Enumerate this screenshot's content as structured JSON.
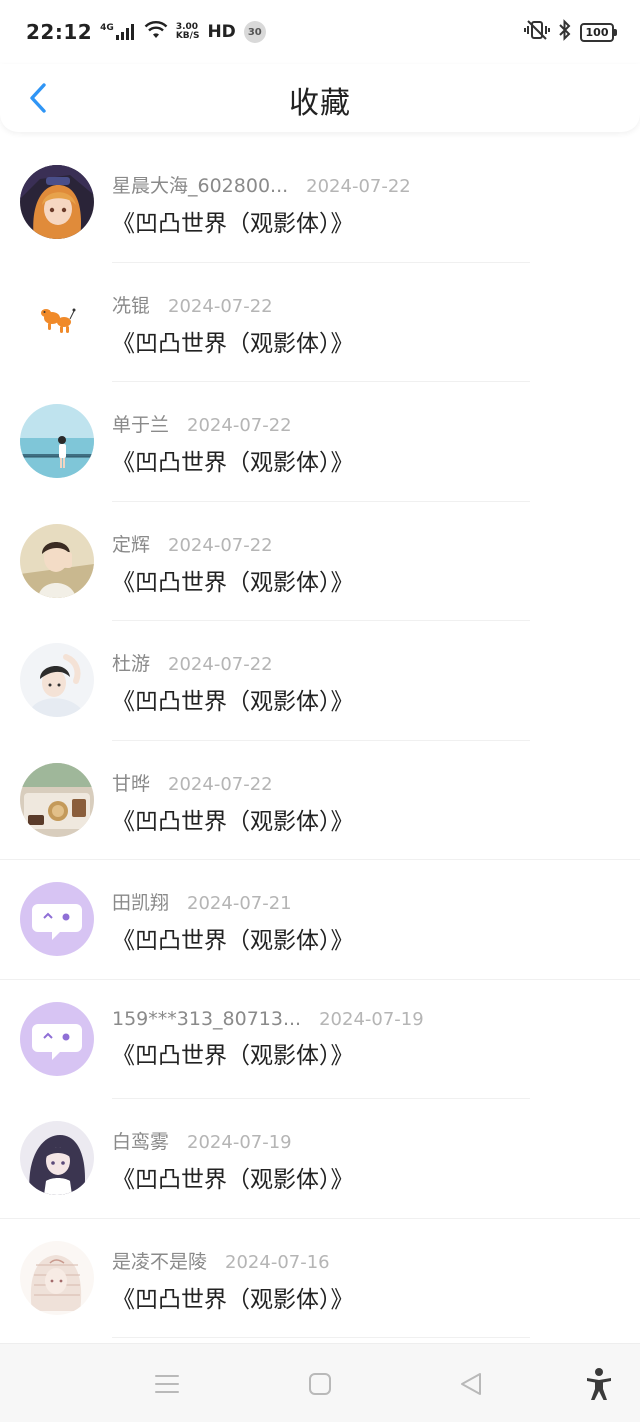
{
  "status_bar": {
    "time": "22:12",
    "network": "4G",
    "speed_value": "3.00",
    "speed_unit": "KB/S",
    "hd": "HD",
    "badge": "30",
    "battery": "100"
  },
  "header": {
    "title": "收藏",
    "back_icon": "chevron-left-icon",
    "accent_color": "#2f95f5"
  },
  "favorites": [
    {
      "name": "星晨大海_602800...",
      "date": "2024-07-22",
      "book": "《凹凸世界（观影体）》",
      "avatar": "anime-girl-avatar"
    },
    {
      "name": "冼锟",
      "date": "2024-07-22",
      "book": "《凹凸世界（观影体）》",
      "avatar": "balloon-dog-avatar"
    },
    {
      "name": "单于兰",
      "date": "2024-07-22",
      "book": "《凹凸世界（观影体）》",
      "avatar": "seaside-photo-avatar"
    },
    {
      "name": "定辉",
      "date": "2024-07-22",
      "book": "《凹凸世界（观影体）》",
      "avatar": "illustrated-boy-avatar"
    },
    {
      "name": "杜游",
      "date": "2024-07-22",
      "book": "《凹凸世界（观影体）》",
      "avatar": "illustrated-boy-avatar"
    },
    {
      "name": "甘晔",
      "date": "2024-07-22",
      "book": "《凹凸世界（观影体）》",
      "avatar": "room-photo-avatar"
    },
    {
      "name": "田凯翔",
      "date": "2024-07-21",
      "book": "《凹凸世界（观影体）》",
      "avatar": "default-chat-avatar"
    },
    {
      "name": "159***313_80713...",
      "date": "2024-07-19",
      "book": "《凹凸世界（观影体）》",
      "avatar": "default-chat-avatar"
    },
    {
      "name": "白鸾雾",
      "date": "2024-07-19",
      "book": "《凹凸世界（观影体）》",
      "avatar": "anime-girl-dark-hair-avatar"
    },
    {
      "name": "是凌不是陵",
      "date": "2024-07-16",
      "book": "《凹凸世界（观影体）》",
      "avatar": "sketch-avatar"
    }
  ],
  "nav_bar": {
    "menu_icon": "menu-icon",
    "home_icon": "home-square-icon",
    "back_icon": "back-triangle-icon",
    "accessibility_icon": "accessibility-icon"
  }
}
